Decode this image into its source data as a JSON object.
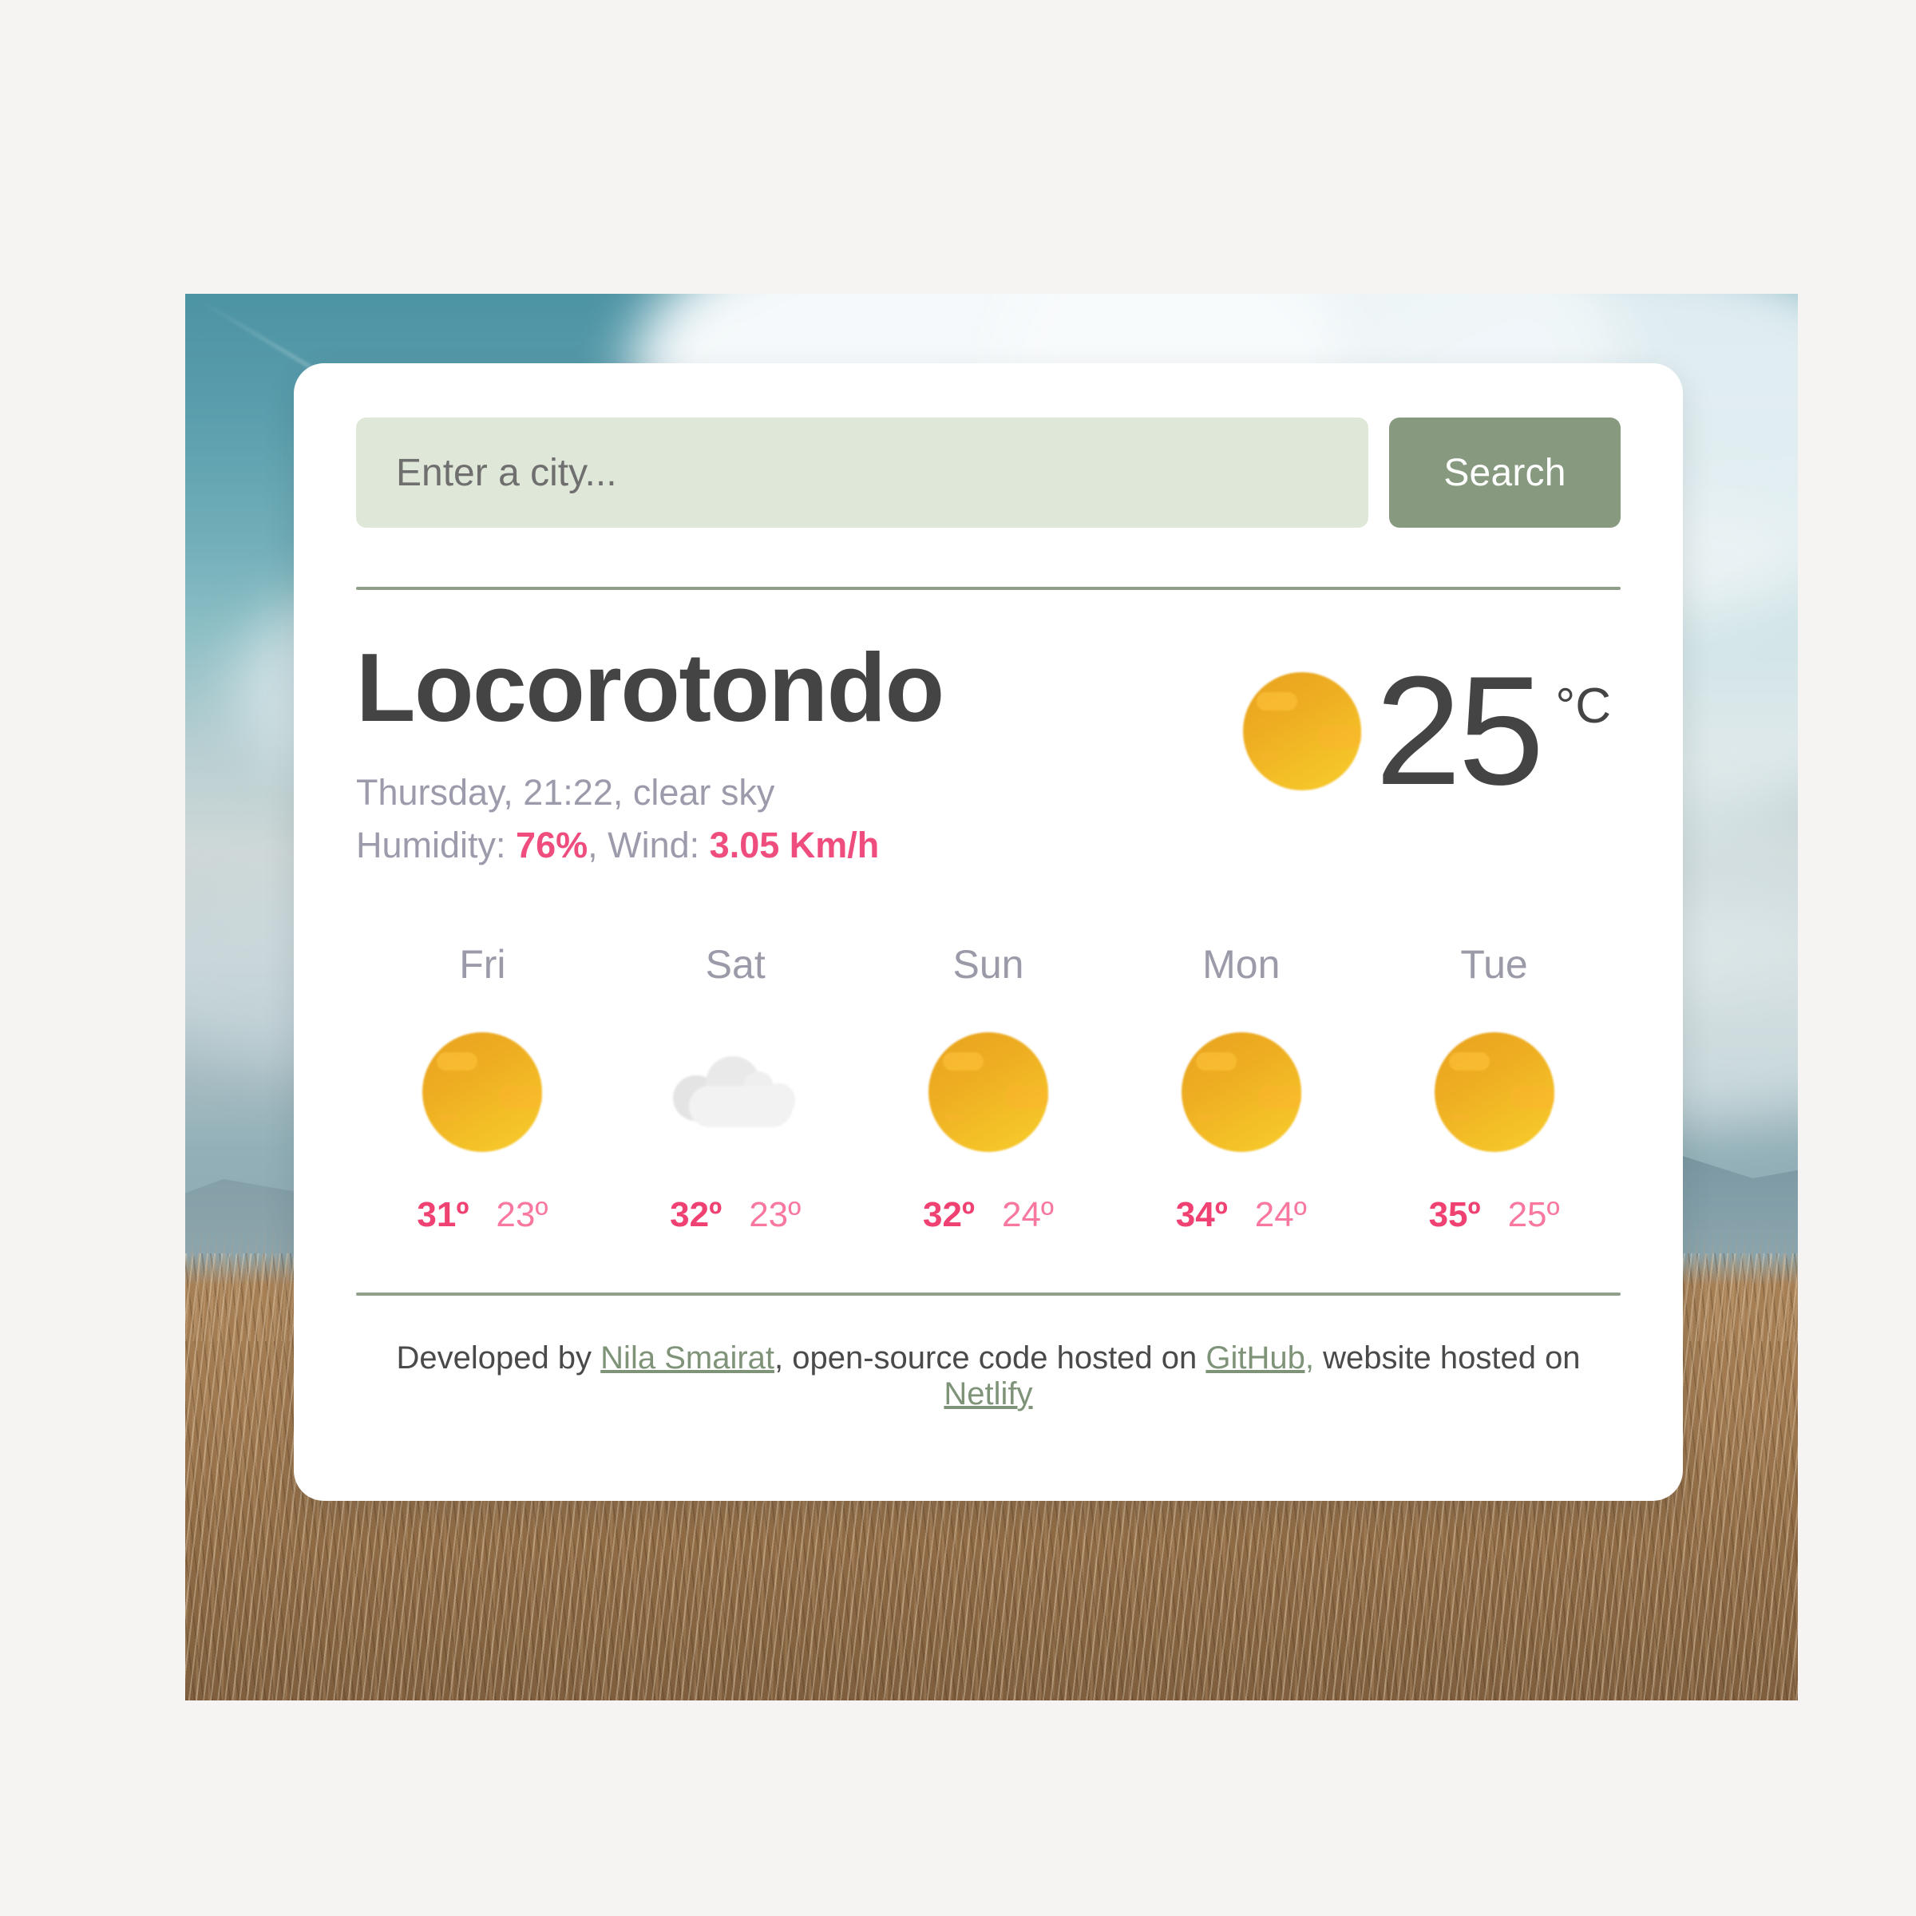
{
  "search": {
    "placeholder": "Enter a city...",
    "value": "",
    "button_label": "Search"
  },
  "current": {
    "city": "Locorotondo",
    "day_time_condition": "Thursday, 21:22, clear sky",
    "humidity_label": "Humidity: ",
    "humidity_value": "76%",
    "wind_label": ", Wind: ",
    "wind_value": "3.05 Km/h",
    "temperature": "25",
    "unit": "°C",
    "icon": "sun-icon"
  },
  "forecast": [
    {
      "day": "Fri",
      "icon": "sun-icon",
      "max": "31º",
      "min": "23º"
    },
    {
      "day": "Sat",
      "icon": "cloud-icon",
      "max": "32º",
      "min": "23º"
    },
    {
      "day": "Sun",
      "icon": "sun-icon",
      "max": "32º",
      "min": "24º"
    },
    {
      "day": "Mon",
      "icon": "sun-icon",
      "max": "34º",
      "min": "24º"
    },
    {
      "day": "Tue",
      "icon": "sun-icon",
      "max": "35º",
      "min": "25º"
    }
  ],
  "footer": {
    "prefix": "Developed by ",
    "author": "Nila Smairat",
    "mid1": ", open-source code hosted on ",
    "repo": "GitHub,",
    "mid2": " website hosted on ",
    "host": "Netlify"
  },
  "colors": {
    "page_background": "#f5f4f2",
    "card_background": "#ffffff",
    "accent_green": "#879a80",
    "input_green": "#dfe8d8",
    "divider_green": "#8f9f8a",
    "accent_pink": "#ef4172",
    "accent_pink_light": "#f8789f",
    "text_dark": "#444444",
    "text_muted": "#9a9aa8",
    "sun_orange": "#e8a21f",
    "sun_yellow": "#f7cd2c",
    "cloud_gray": "#ededed"
  }
}
